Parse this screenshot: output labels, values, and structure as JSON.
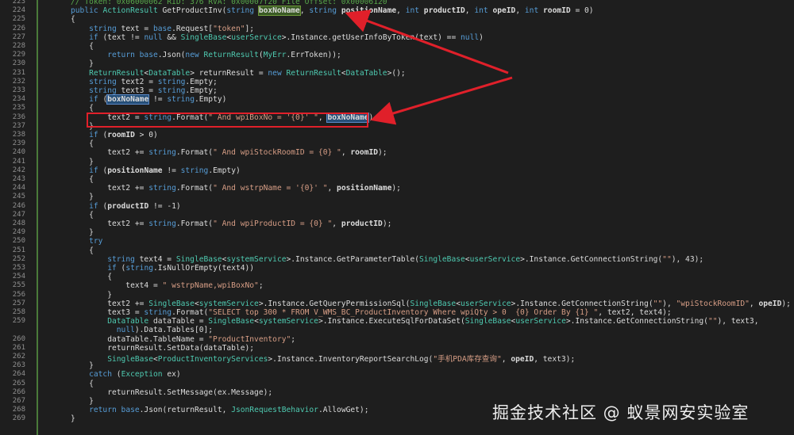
{
  "editor": {
    "lines": [
      {
        "n": "223",
        "t": "    // Token: 0x06000062 RID: 376 RVA: 0x00007f20 File Offset: 0x00006120"
      },
      {
        "n": "224",
        "t": "    public ActionResult GetProductInv(string boxNoName, string positionName, int productID, int opeID, int roomID = 0)"
      },
      {
        "n": "225",
        "t": "    {"
      },
      {
        "n": "226",
        "t": "        string text = base.Request[\"token\"];"
      },
      {
        "n": "227",
        "t": "        if (text != null && SingleBase<userService>.Instance.getUserInfoByToken(text) == null)"
      },
      {
        "n": "228",
        "t": "        {"
      },
      {
        "n": "229",
        "t": "            return base.Json(new ReturnResult(MyErr.ErrToken));"
      },
      {
        "n": "230",
        "t": "        }"
      },
      {
        "n": "231",
        "t": "        ReturnResult<DataTable> returnResult = new ReturnResult<DataTable>();"
      },
      {
        "n": "232",
        "t": "        string text2 = string.Empty;"
      },
      {
        "n": "233",
        "t": "        string text3 = string.Empty;"
      },
      {
        "n": "234",
        "t": "        if (boxNoName != string.Empty)"
      },
      {
        "n": "235",
        "t": "        {"
      },
      {
        "n": "236",
        "t": "            text2 = string.Format(\" And wpiBoxNo = '{0}' \", boxNoName);"
      },
      {
        "n": "237",
        "t": "        }"
      },
      {
        "n": "238",
        "t": "        if (roomID > 0)"
      },
      {
        "n": "239",
        "t": "        {"
      },
      {
        "n": "240",
        "t": "            text2 += string.Format(\" And wpiStockRoomID = {0} \", roomID);"
      },
      {
        "n": "241",
        "t": "        }"
      },
      {
        "n": "242",
        "t": "        if (positionName != string.Empty)"
      },
      {
        "n": "243",
        "t": "        {"
      },
      {
        "n": "244",
        "t": "            text2 += string.Format(\" And wstrpName = '{0}' \", positionName);"
      },
      {
        "n": "245",
        "t": "        }"
      },
      {
        "n": "246",
        "t": "        if (productID != -1)"
      },
      {
        "n": "247",
        "t": "        {"
      },
      {
        "n": "248",
        "t": "            text2 += string.Format(\" And wpiProductID = {0} \", productID);"
      },
      {
        "n": "249",
        "t": "        }"
      },
      {
        "n": "250",
        "t": "        try"
      },
      {
        "n": "251",
        "t": "        {"
      },
      {
        "n": "252",
        "t": "            string text4 = SingleBase<systemService>.Instance.GetParameterTable(SingleBase<userService>.Instance.GetConnectionString(\"\"), 43);"
      },
      {
        "n": "253",
        "t": "            if (string.IsNullOrEmpty(text4))"
      },
      {
        "n": "254",
        "t": "            {"
      },
      {
        "n": "255",
        "t": "                text4 = \" wstrpName,wpiBoxNo\";"
      },
      {
        "n": "256",
        "t": "            }"
      },
      {
        "n": "257",
        "t": "            text2 += SingleBase<systemService>.Instance.GetQueryPermissionSql(SingleBase<userService>.Instance.GetConnectionString(\"\"), \"wpiStockRoomID\", opeID);"
      },
      {
        "n": "258",
        "t": "            text3 = string.Format(\"SELECT top 300 * FROM V_WMS_BC_ProductInventory Where wpiQty > 0  {0} Order By {1} \", text2, text4);"
      },
      {
        "n": "259",
        "t": "            DataTable dataTable = SingleBase<systemService>.Instance.ExecuteSqlForDataSet(SingleBase<userService>.Instance.GetConnectionString(\"\"), text3,"
      },
      {
        "n": "",
        "t": "              null).Data.Tables[0];"
      },
      {
        "n": "260",
        "t": "            dataTable.TableName = \"ProductInventory\";"
      },
      {
        "n": "261",
        "t": "            returnResult.SetData(dataTable);"
      },
      {
        "n": "262",
        "t": "            SingleBase<ProductInventoryServices>.Instance.InventoryReportSearchLog(\"手机PDA库存查询\", opeID, text3);"
      },
      {
        "n": "263",
        "t": "        }"
      },
      {
        "n": "264",
        "t": "        catch (Exception ex)"
      },
      {
        "n": "265",
        "t": "        {"
      },
      {
        "n": "266",
        "t": "            returnResult.SetMessage(ex.Message);"
      },
      {
        "n": "267",
        "t": "        }"
      },
      {
        "n": "268",
        "t": "        return base.Json(returnResult, JsonRequestBehavior.AllowGet);"
      },
      {
        "n": "269",
        "t": "    }"
      }
    ]
  },
  "watermark": {
    "text": "掘金技术社区 @ 蚁景网安实验室"
  },
  "colors": {
    "background": "#1e1e1e",
    "keyword": "#569cd6",
    "type": "#4ec9b0",
    "string": "#d69d85",
    "method": "#dcdcaa",
    "annotation": "#e0202a"
  }
}
